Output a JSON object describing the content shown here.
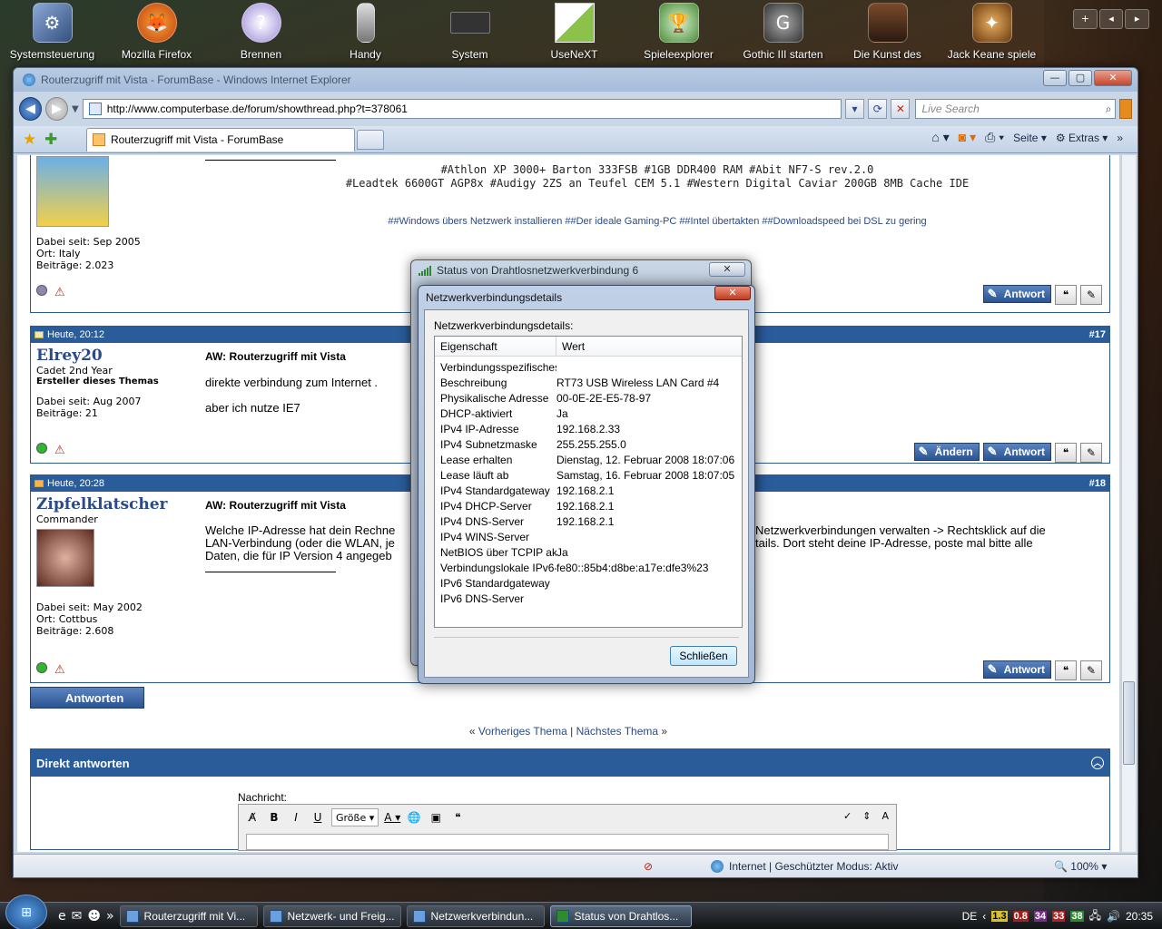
{
  "desktop": {
    "icons": [
      {
        "label": "Systemsteuerung",
        "icon": "control-panel-icon"
      },
      {
        "label": "Mozilla Firefox",
        "icon": "firefox-icon"
      },
      {
        "label": "Brennen",
        "icon": "disc-icon"
      },
      {
        "label": "Handy",
        "icon": "phone-icon"
      },
      {
        "label": "System",
        "icon": "chip-icon"
      },
      {
        "label": "UseNeXT",
        "icon": "usenext-icon"
      },
      {
        "label": "Spieleexplorer",
        "icon": "trophy-icon"
      },
      {
        "label": "Gothic III starten",
        "icon": "gothic-icon"
      },
      {
        "label": "Die Kunst des",
        "icon": "game-icon"
      },
      {
        "label": "Jack Keane spiele",
        "icon": "game-icon"
      }
    ]
  },
  "ie": {
    "title": "Routerzugriff mit Vista - ForumBase - Windows Internet Explorer",
    "url": "http://www.computerbase.de/forum/showthread.php?t=378061",
    "search_placeholder": "Live Search",
    "tab_label": "Routerzugriff mit Vista - ForumBase",
    "cmd": {
      "seite": "Seite",
      "extras": "Extras"
    },
    "status": {
      "zone": "Internet | Geschützter Modus: Aktiv",
      "zoom": "100%"
    }
  },
  "posts": {
    "p16": {
      "join": "Dabei seit: Sep 2005",
      "ort": "Ort: Italy",
      "beitraege": "Beiträge: 2.023",
      "sig1": "#Athlon XP 3000+ Barton 333FSB #1GB DDR400 RAM #Abit NF7-S rev.2.0",
      "sig2": "#Leadtek 6600GT AGP8x #Audigy 2ZS an Teufel CEM 5.1 #Western Digital Caviar 200GB 8MB Cache IDE",
      "links": "##Windows übers Netzwerk installieren ##Der ideale Gaming-PC ##Intel übertakten ##Downloadspeed bei DSL zu gering",
      "antwort": "Antwort"
    },
    "p17": {
      "time": "Heute, 20:12",
      "num": "#17",
      "user": "Elrey20",
      "rank": "Cadet 2nd Year",
      "starter": "Ersteller dieses Themas",
      "join": "Dabei seit: Aug 2007",
      "beitraege": "Beiträge: 21",
      "title": "AW: Routerzugriff mit Vista",
      "line1": "direkte verbindung zum Internet .",
      "line2": "aber ich nutze IE7",
      "aendern": "Ändern",
      "antwort": "Antwort"
    },
    "p18": {
      "time": "Heute, 20:28",
      "num": "#18",
      "user": "Zipfelklatscher",
      "rank": "Commander",
      "join": "Dabei seit: May 2002",
      "ort": "Ort: Cottbus",
      "beitraege": "Beiträge: 2.608",
      "title": "AW: Routerzugriff mit Vista",
      "text_left1": "Welche IP-Adresse hat dein Rechne",
      "text_left2": "LAN-Verbindung (oder die WLAN, je",
      "text_left3": "Daten, die für IP Version 4 angegeb",
      "text_right1": "Netzwerkverbindungen verwalten -> Rechtsklick auf die",
      "text_right2": "tails. Dort steht deine IP-Adresse, poste mal bitte alle",
      "antwort": "Antwort"
    }
  },
  "page": {
    "antworten": "Antworten",
    "prev": "Vorheriges Thema",
    "sep": "|",
    "next": "Nächstes Thema",
    "direkt": "Direkt antworten",
    "nachricht": "Nachricht:",
    "groesse": "Größe"
  },
  "dialog_outer": {
    "title": "Status von Drahtlosnetzwerkverbindung 6"
  },
  "dialog": {
    "title": "Netzwerkverbindungsdetails",
    "label": "Netzwerkverbindungsdetails:",
    "col1": "Eigenschaft",
    "col2": "Wert",
    "close": "Schließen",
    "rows": [
      {
        "k": "Verbindungsspezifisches...",
        "v": ""
      },
      {
        "k": "Beschreibung",
        "v": "RT73 USB Wireless LAN Card #4"
      },
      {
        "k": "Physikalische Adresse",
        "v": "00-0E-2E-E5-78-97"
      },
      {
        "k": "DHCP-aktiviert",
        "v": "Ja"
      },
      {
        "k": "IPv4 IP-Adresse",
        "v": "192.168.2.33"
      },
      {
        "k": "IPv4 Subnetzmaske",
        "v": "255.255.255.0"
      },
      {
        "k": "Lease erhalten",
        "v": "Dienstag, 12. Februar 2008 18:07:06"
      },
      {
        "k": "Lease läuft ab",
        "v": "Samstag, 16. Februar 2008 18:07:05"
      },
      {
        "k": "IPv4 Standardgateway",
        "v": "192.168.2.1"
      },
      {
        "k": "IPv4 DHCP-Server",
        "v": "192.168.2.1"
      },
      {
        "k": "IPv4 DNS-Server",
        "v": "192.168.2.1"
      },
      {
        "k": "IPv4 WINS-Server",
        "v": ""
      },
      {
        "k": "NetBIOS über TCPIP ak...",
        "v": "Ja"
      },
      {
        "k": "Verbindungslokale IPv6-...",
        "v": "fe80::85b4:d8be:a17e:dfe3%23"
      },
      {
        "k": "IPv6 Standardgateway",
        "v": ""
      },
      {
        "k": "IPv6 DNS-Server",
        "v": ""
      }
    ]
  },
  "taskbar": {
    "tasks": [
      "Routerzugriff mit Vi...",
      "Netzwerk- und Freig...",
      "Netzwerkverbindun...",
      "Status von Drahtlos..."
    ],
    "lang": "DE",
    "tray_nums": [
      "1.3",
      "0.8",
      "34",
      "33",
      "38"
    ],
    "clock": "20:35"
  }
}
